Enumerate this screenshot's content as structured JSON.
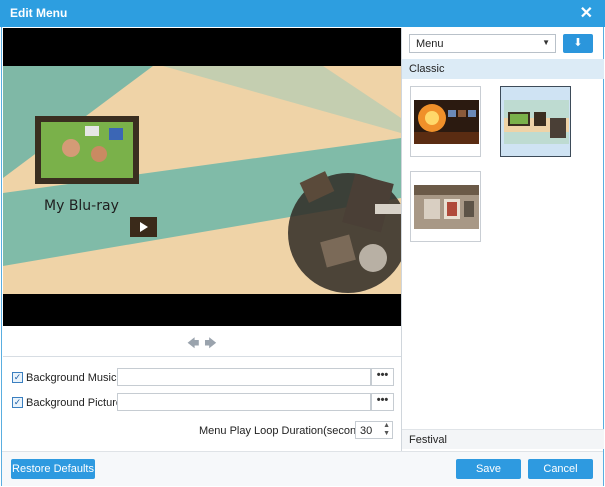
{
  "window": {
    "title": "Edit Menu",
    "close_glyph": "✕"
  },
  "preview": {
    "menu_title_text": "My Blu-ray",
    "play_icon": "play-icon"
  },
  "nav": {
    "prev_glyph": "🡄",
    "next_glyph": "🡆"
  },
  "form": {
    "background_music_label": "Background Music:",
    "background_music_value": "",
    "background_picture_label": "Background Picture:",
    "background_picture_value": "",
    "browse_label": "•••",
    "loop_label": "Menu Play Loop Duration(seconds):",
    "loop_value": "30"
  },
  "template_panel": {
    "select_value": "Menu",
    "download_icon": "download-icon",
    "download_glyph": "⬇",
    "categories": [
      "Classic",
      "Festival"
    ]
  },
  "buttons": {
    "restore_defaults": "Restore Defaults",
    "save": "Save",
    "cancel": "Cancel"
  },
  "colors": {
    "accent": "#2d9ee0",
    "title_bar": "#2d9ee0",
    "section_highlight": "#dcebf6"
  }
}
